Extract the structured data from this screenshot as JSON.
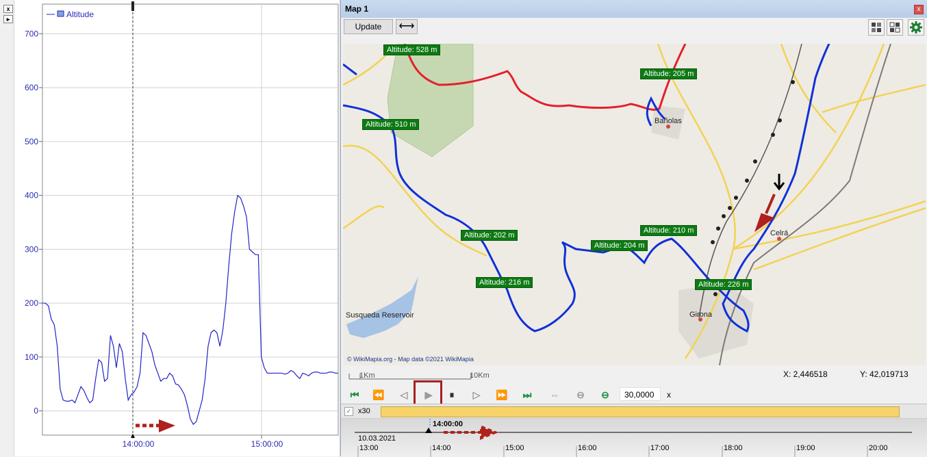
{
  "chart_pane": {
    "buttons": {
      "close": "x",
      "expand": "▸"
    },
    "legend": "Altitude",
    "chart_data": {
      "type": "line",
      "series": [
        {
          "name": "Altitude",
          "x": [
            0.0,
            0.01,
            0.02,
            0.03,
            0.04,
            0.05,
            0.06,
            0.07,
            0.08,
            0.09,
            0.1,
            0.11,
            0.12,
            0.13,
            0.14,
            0.15,
            0.16,
            0.17,
            0.18,
            0.19,
            0.2,
            0.21,
            0.22,
            0.23,
            0.24,
            0.25,
            0.26,
            0.27,
            0.28,
            0.29,
            0.3,
            0.31,
            0.32,
            0.33,
            0.34,
            0.35,
            0.36,
            0.37,
            0.38,
            0.39,
            0.4,
            0.41,
            0.42,
            0.43,
            0.44,
            0.45,
            0.46,
            0.47,
            0.48,
            0.49,
            0.5,
            0.51,
            0.52,
            0.53,
            0.54,
            0.55,
            0.56,
            0.57,
            0.58,
            0.59,
            0.6,
            0.61,
            0.62,
            0.63,
            0.64,
            0.65,
            0.66,
            0.67,
            0.68,
            0.69,
            0.7,
            0.71,
            0.72,
            0.73,
            0.74,
            0.75,
            0.76,
            0.77,
            0.78,
            0.79,
            0.8,
            0.81,
            0.82,
            0.83,
            0.84,
            0.85,
            0.86,
            0.87,
            0.88,
            0.89,
            0.9,
            0.91,
            0.92,
            0.93,
            0.94,
            0.95,
            0.96,
            0.97,
            0.98,
            0.99,
            1.0
          ],
          "y_note": "time fraction mapped to axis in script",
          "values": [
            200,
            200,
            195,
            170,
            160,
            120,
            40,
            20,
            18,
            18,
            20,
            15,
            30,
            45,
            38,
            25,
            15,
            20,
            60,
            95,
            90,
            55,
            60,
            140,
            120,
            80,
            125,
            110,
            60,
            20,
            30,
            35,
            45,
            70,
            145,
            140,
            125,
            110,
            85,
            70,
            55,
            60,
            60,
            70,
            65,
            50,
            48,
            40,
            30,
            10,
            -15,
            -25,
            -20,
            0,
            20,
            60,
            120,
            145,
            150,
            145,
            120,
            150,
            200,
            270,
            330,
            370,
            400,
            395,
            380,
            360,
            300,
            295,
            290,
            290,
            100,
            80,
            70,
            70,
            70,
            70,
            70,
            70,
            68,
            70,
            75,
            72,
            65,
            60,
            70,
            68,
            65,
            70,
            72,
            72,
            70,
            70,
            70,
            72,
            72,
            70,
            70
          ]
        }
      ],
      "x_axis": {
        "ticks": [
          "14:00:00",
          "15:00:00"
        ]
      },
      "y_axis": {
        "ticks": [
          "0",
          "100",
          "200",
          "300",
          "400",
          "500",
          "600",
          "700"
        ],
        "ylim": [
          -45,
          755
        ]
      },
      "grid": true,
      "legend_placement": "top-left"
    }
  },
  "map_window": {
    "title": "Map 1",
    "close_label": "x",
    "toolbar": {
      "update_label": "Update",
      "fit_icon": "double-arrow-icon"
    },
    "map": {
      "place_names": [
        "Bañolas",
        "Celrá",
        "Girona",
        "Susqueda Reservoir"
      ],
      "altitude_labels": [
        "Altitude: 528 m",
        "Altitude: 205 m",
        "Altitude: 510 m",
        "Altitude: 202 m",
        "Altitude: 210 m",
        "Altitude: 204 m",
        "Altitude: 216 m",
        "Altitude: 226 m"
      ],
      "copyright": "© WikiMapia.org - Map data ©2021 WikiMapia",
      "scale": {
        "a": "1Km",
        "b": "10Km"
      },
      "coords": {
        "x": "X: 2,446518",
        "y": "Y: 42,019713"
      }
    },
    "player": {
      "speed_value": "30,0000",
      "speed_unit": "x"
    },
    "timeline": {
      "speed_label": "x30",
      "cursor_time": "14:00:00",
      "date": "10.03.2021",
      "hours": [
        "13:00",
        "14:00",
        "15:00",
        "16:00",
        "17:00",
        "18:00",
        "19:00",
        "20:00"
      ]
    }
  }
}
